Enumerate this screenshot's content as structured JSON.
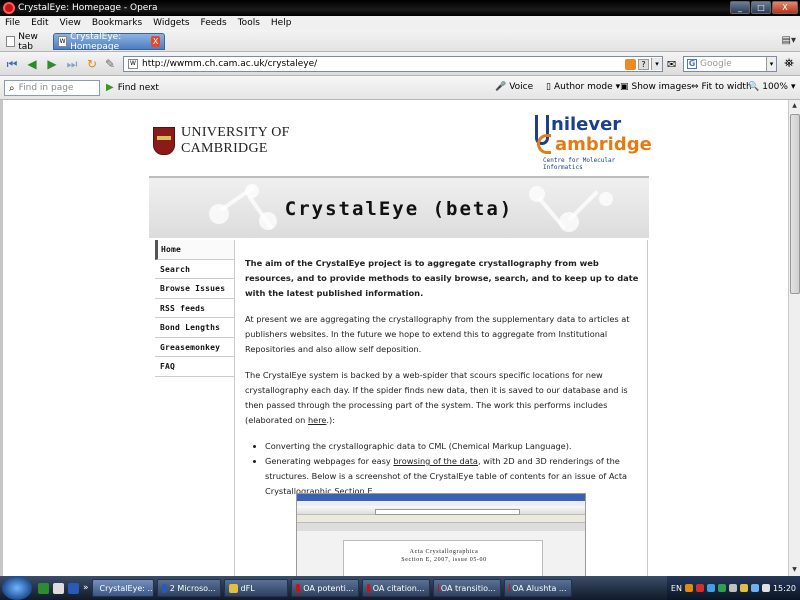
{
  "window": {
    "title": "CrystalEye: Homepage - Opera",
    "min": "_",
    "max": "□",
    "close": "X"
  },
  "menu": [
    "File",
    "Edit",
    "View",
    "Bookmarks",
    "Widgets",
    "Feeds",
    "Tools",
    "Help"
  ],
  "tabs": {
    "new_tab": "New tab",
    "active": "CrystalEye: Homepage",
    "close": "X"
  },
  "address": {
    "url": "http://wwmm.ch.cam.ac.uk/crystaleye/",
    "search_placeholder": "Google"
  },
  "findbar": {
    "placeholder": "Find in page",
    "find_next": "Find next",
    "voice": "Voice",
    "author_mode": "Author mode",
    "show_images": "Show images",
    "fit_width": "Fit to width",
    "zoom": "100%"
  },
  "page": {
    "cambridge_line1": "UNIVERSITY OF",
    "cambridge_line2": "CAMBRIDGE",
    "unilever_line1": "nilever",
    "unilever_line2": "ambridge",
    "unilever_line3": "Centre for Molecular Informatics",
    "banner_title": "CrystalEye (beta)",
    "nav": [
      "Home",
      "Search",
      "Browse Issues",
      "RSS feeds",
      "Bond Lengths",
      "Greasemonkey",
      "FAQ"
    ],
    "lead": "The aim of the CrystalEye project is to aggregate crystallography from web resources, and to provide methods to easily browse, search, and to keep up to date with the latest published information.",
    "p1": "At present we are aggregating the crystallography from the supplementary data to articles at publishers websites. In the future we hope to extend this to aggregate from Institutional Repositories and also allow self deposition.",
    "p2_a": "The CrystalEye system is backed by a web-spider that scours specific locations for new crystallography each day. If the spider finds new data, then it is saved to our database and is then passed through the processing part of the system. The work this performs includes (elaborated on ",
    "p2_link": "here",
    "p2_b": ".):",
    "li1": "Converting the crystallographic data to CML (Chemical Markup Language).",
    "li2_a": "Generating webpages for easy ",
    "li2_link": "browsing of the data",
    "li2_b": ", with 2D and 3D renderings of the structures. Below is a screenshot of the CrystalEye table of contents for an issue of Acta Crystallographic Section E.",
    "shot_title_1": "Acta Crystallographica",
    "shot_title_2": "Section E, 2007, issue 05-00"
  },
  "taskbar": {
    "items": [
      "CrystalEye: ...",
      "2 Microso...",
      "dFL",
      "OA potenti...",
      "OA citation...",
      "OA transitio...",
      "OA Alushta ..."
    ],
    "lang": "EN",
    "clock": "15:20"
  }
}
